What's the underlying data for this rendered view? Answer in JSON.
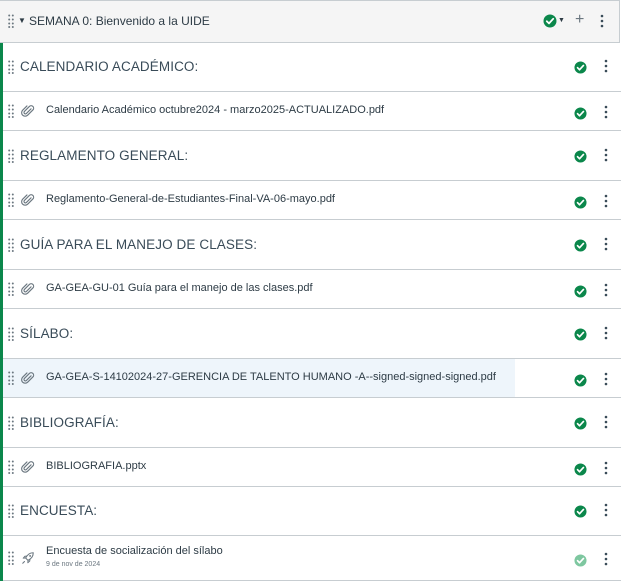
{
  "module": {
    "title": "SEMANA 0: Bienvenido a la UIDE",
    "icons": {
      "drag": "drag-handle-icon",
      "collapse": "caret-down-icon",
      "publish": "check-circle-icon",
      "add": "plus-icon",
      "menu": "kebab-menu-icon"
    },
    "colors": {
      "published": "#0b874b",
      "published_light": "#7ec7a0",
      "row_highlight": "#eef5fb"
    }
  },
  "items": [
    {
      "kind": "subheader",
      "label": "CALENDARIO ACADÉMICO:"
    },
    {
      "kind": "file",
      "icon": "paperclip-icon",
      "label": "Calendario Académico octubre2024 - marzo2025-ACTUALIZADO.pdf"
    },
    {
      "kind": "subheader",
      "label": "REGLAMENTO GENERAL:"
    },
    {
      "kind": "file",
      "icon": "paperclip-icon",
      "label": "Reglamento-General-de-Estudiantes-Final-VA-06-mayo.pdf"
    },
    {
      "kind": "subheader",
      "label": "GUÍA PARA EL MANEJO DE CLASES:"
    },
    {
      "kind": "file",
      "icon": "paperclip-icon",
      "label": "GA-GEA-GU-01 Guía para el manejo de las clases.pdf"
    },
    {
      "kind": "subheader",
      "label": "SÍLABO:"
    },
    {
      "kind": "file",
      "icon": "paperclip-icon",
      "label": "GA-GEA-S-14102024-27-GERENCIA DE TALENTO HUMANO -A--signed-signed-signed.pdf"
    },
    {
      "kind": "subheader",
      "label": "BIBLIOGRAFÍA:"
    },
    {
      "kind": "file",
      "icon": "paperclip-icon",
      "label": "BIBLIOGRAFIA.pptx"
    },
    {
      "kind": "subheader",
      "label": "ENCUESTA:"
    },
    {
      "kind": "quiz",
      "icon": "rocket-icon",
      "label": "Encuesta de socialización del sílabo",
      "date": "9 de nov de 2024"
    }
  ]
}
